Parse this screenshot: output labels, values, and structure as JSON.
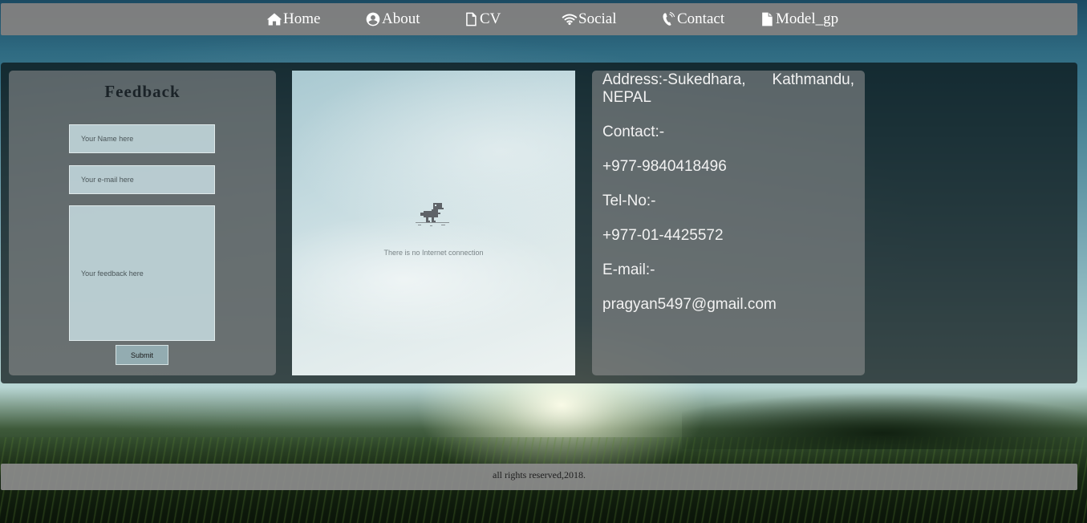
{
  "nav": {
    "items": [
      {
        "label": "Home",
        "icon": "home-icon"
      },
      {
        "label": "About",
        "icon": "user-circle-icon"
      },
      {
        "label": "CV",
        "icon": "document-outline-icon"
      },
      {
        "label": "Social",
        "icon": "wifi-icon"
      },
      {
        "label": "Contact",
        "icon": "phone-icon"
      },
      {
        "label": "Model_gp",
        "icon": "document-filled-icon"
      }
    ]
  },
  "feedback": {
    "title": "Feedback",
    "name_placeholder": "Your Name here",
    "email_placeholder": "Your e-mail here",
    "feedback_placeholder": "Your feedback here",
    "submit_label": "Submit"
  },
  "map": {
    "offline_message": "There is no Internet connection",
    "icon": "dinosaur-icon"
  },
  "contact": {
    "address": "Address:-Sukedhara, Kathmandu, NEPAL",
    "contact_label": "Contact:-",
    "contact_number": "+977-9840418496",
    "tel_label": "Tel-No:-",
    "tel_number": "+977-01-4425572",
    "email_label": "E-mail:-",
    "email": "pragyan5497@gmail.com"
  },
  "footer": {
    "text": "all rights reserved,2018."
  },
  "colors": {
    "navbar_bg": "#808080",
    "panel_text": "#f2f2f2",
    "input_bg": "#cde4e9"
  }
}
